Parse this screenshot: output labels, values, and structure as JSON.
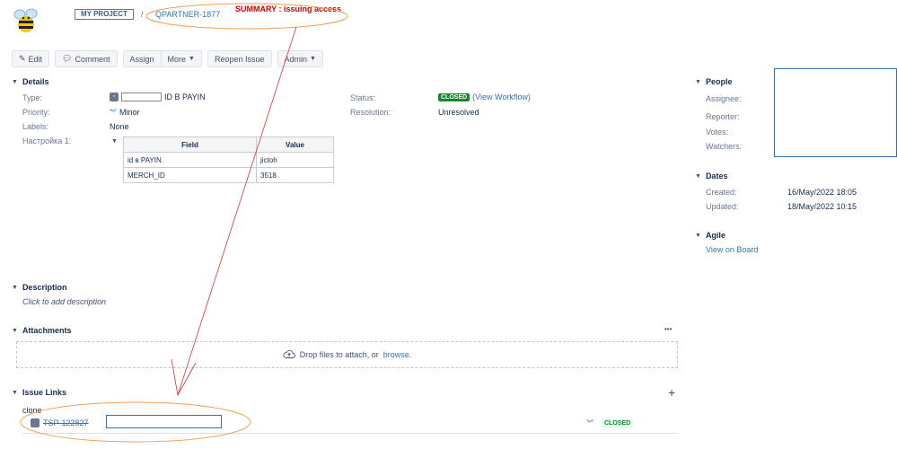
{
  "header": {
    "project_label": "MY PROJECT",
    "separator": "/",
    "issue_key": "QPARTNER-1877",
    "summary_note": "SUMMARY : issuing access"
  },
  "toolbar": {
    "edit": "Edit",
    "comment": "Comment",
    "assign": "Assign",
    "more": "More",
    "reopen": "Reopen Issue",
    "admin": "Admin"
  },
  "details": {
    "heading": "Details",
    "type_label": "Type:",
    "type_value": "ID B PAYIN",
    "priority_label": "Priority:",
    "priority_value": "Minor",
    "labels_label": "Labels:",
    "labels_value": "None",
    "custom_label": "Настройка 1:",
    "status_label": "Status:",
    "status_value": "CLOSED",
    "view_workflow": "(View Workflow)",
    "resolution_label": "Resolution:",
    "resolution_value": "Unresolved",
    "table": {
      "headers": [
        "Field",
        "Value"
      ],
      "rows": [
        [
          "id в PAYIN",
          "jictoh"
        ],
        [
          "MERCH_ID",
          "3518"
        ]
      ]
    }
  },
  "people": {
    "heading": "People",
    "assignee": "Assignee:",
    "reporter": "Reporter:",
    "votes": "Votes:",
    "watchers": "Watchers:"
  },
  "dates": {
    "heading": "Dates",
    "created_label": "Created:",
    "created_value": "16/May/2022 18:05",
    "updated_label": "Updated:",
    "updated_value": "18/May/2022 10:15"
  },
  "agile": {
    "heading": "Agile",
    "view_on_board": "View on Board"
  },
  "description": {
    "heading": "Description",
    "placeholder": "Click to add description"
  },
  "attachments": {
    "heading": "Attachments",
    "more": "•••",
    "drop_text": "Drop files to attach, or",
    "browse": "browse."
  },
  "issue_links": {
    "heading": "Issue Links",
    "add": "+",
    "relation": "clone",
    "link_key": "TSP-122827",
    "link_status": "CLOSED"
  },
  "colors": {
    "annotation": "#e03030",
    "annotation_ellipse": "#f0a050",
    "link": "#3572b0",
    "closed": "#14892c"
  }
}
